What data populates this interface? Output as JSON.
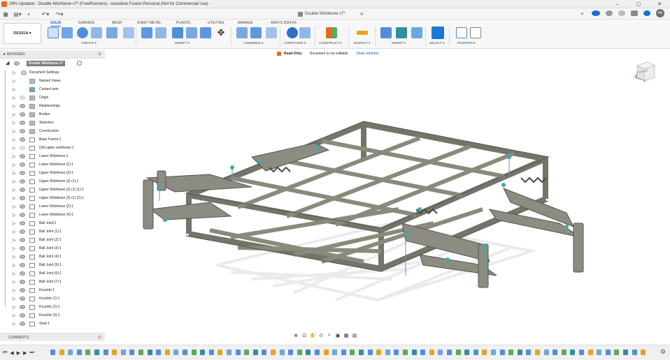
{
  "window": {
    "title": "29% Updated - Double Wishbone v7* (FreeRunners) - Autodesk Fusion Personal (Not for Commercial Use)",
    "controls": [
      "–",
      "▢",
      "✕"
    ]
  },
  "document_tab": {
    "label": "Double Wishbone v7*"
  },
  "user": {
    "initials": "AB"
  },
  "ribbon": {
    "workspace": "DESIGN",
    "tabs": [
      "SOLID",
      "SURFACE",
      "MESH",
      "SHEET METAL",
      "PLASTIC",
      "UTILITIES",
      "MANAGE",
      "ANSYS 2024 R1"
    ],
    "active_tab": "SOLID",
    "groups": [
      "CREATE",
      "MODIFY",
      "ASSEMBLE",
      "CONFIGURE",
      "CONSTRUCT",
      "INSPECT",
      "INSERT",
      "SELECT",
      "POSITION"
    ]
  },
  "browser": {
    "title": "BROWSER",
    "root": "Double Wishbone v7",
    "items": [
      {
        "label": "Document Settings",
        "icon": "gear-icon",
        "eye": false
      },
      {
        "label": "Named Views",
        "icon": "folder-icon",
        "eye": false
      },
      {
        "label": "Contact sets",
        "icon": "contact-icon",
        "eye": false
      },
      {
        "label": "Origin",
        "icon": "folder-icon",
        "eye": true,
        "dim": true
      },
      {
        "label": "Relationships",
        "icon": "folder-icon",
        "eye": true
      },
      {
        "label": "Bodies",
        "icon": "folder-icon",
        "eye": true
      },
      {
        "label": "Sketches",
        "icon": "folder-icon",
        "eye": true
      },
      {
        "label": "Construction",
        "icon": "folder-icon",
        "eye": true
      },
      {
        "label": "Base Frame:1",
        "icon": "component-icon",
        "eye": true
      },
      {
        "label": "Old Upper wishbone:1",
        "icon": "component-icon",
        "eye": true,
        "dim": true
      },
      {
        "label": "Lower Wishbone:1",
        "icon": "component-icon",
        "eye": true
      },
      {
        "label": "Lower Wishbone (1):1",
        "icon": "component-icon",
        "eye": true
      },
      {
        "label": "Upper Wishbone (3):1",
        "icon": "component-icon",
        "eye": true
      },
      {
        "label": "Upper Wishbone (3) (1):1",
        "icon": "component-icon",
        "eye": true
      },
      {
        "label": "Upper Wishbone (3) (1) (1):1",
        "icon": "component-icon",
        "eye": true
      },
      {
        "label": "Upper Wishbone (3) (1) (2):1",
        "icon": "component-icon",
        "eye": true
      },
      {
        "label": "Lower Wishbone (2):1",
        "icon": "component-icon",
        "eye": true
      },
      {
        "label": "Lower Wishbone (4):1",
        "icon": "component-icon",
        "eye": true
      },
      {
        "label": "Ball Joint:1",
        "icon": "component-icon",
        "eye": true
      },
      {
        "label": "Ball Joint (1):1",
        "icon": "component-icon",
        "eye": true
      },
      {
        "label": "Ball Joint (2):1",
        "icon": "component-icon",
        "eye": true
      },
      {
        "label": "Ball Joint (3):1",
        "icon": "component-icon",
        "eye": true
      },
      {
        "label": "Ball Joint (4):1",
        "icon": "component-icon",
        "eye": true
      },
      {
        "label": "Ball Joint (5):1",
        "icon": "component-icon",
        "eye": true
      },
      {
        "label": "Ball Joint (6):1",
        "icon": "component-icon",
        "eye": true
      },
      {
        "label": "Ball Joint (7):1",
        "icon": "component-icon",
        "eye": true
      },
      {
        "label": "Knuckle:1",
        "icon": "component-icon",
        "eye": true
      },
      {
        "label": "Knuckle (1):1",
        "icon": "component-icon",
        "eye": true
      },
      {
        "label": "Knuckle (2):1",
        "icon": "component-icon",
        "eye": true
      },
      {
        "label": "Knuckle (3):1",
        "icon": "component-icon",
        "eye": true
      },
      {
        "label": "Strut:1",
        "icon": "component-icon",
        "eye": true
      }
    ]
  },
  "readonly_bar": {
    "status": "Read-Only:",
    "message": "Document is not editable",
    "action": "Make Editable"
  },
  "viewcube": {
    "face": "FRONT",
    "axis_x": "X",
    "axis_z": "Z"
  },
  "comments": {
    "title": "COMMENTS"
  },
  "colors": {
    "accent": "#1a6fd1",
    "frame": "#8a8a7c",
    "joint": "#3fa7b0",
    "orange": "#e8691e"
  }
}
